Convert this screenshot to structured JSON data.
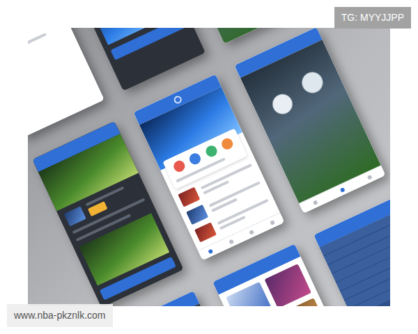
{
  "watermarks": {
    "top": "TG: MYYJJPP",
    "bottom": "www.nba-pkznlk.com"
  },
  "shortcut_icons": [
    {
      "color": "#e8584d"
    },
    {
      "color": "#3b7de0"
    },
    {
      "color": "#3cb371"
    },
    {
      "color": "#f08a3c"
    }
  ]
}
